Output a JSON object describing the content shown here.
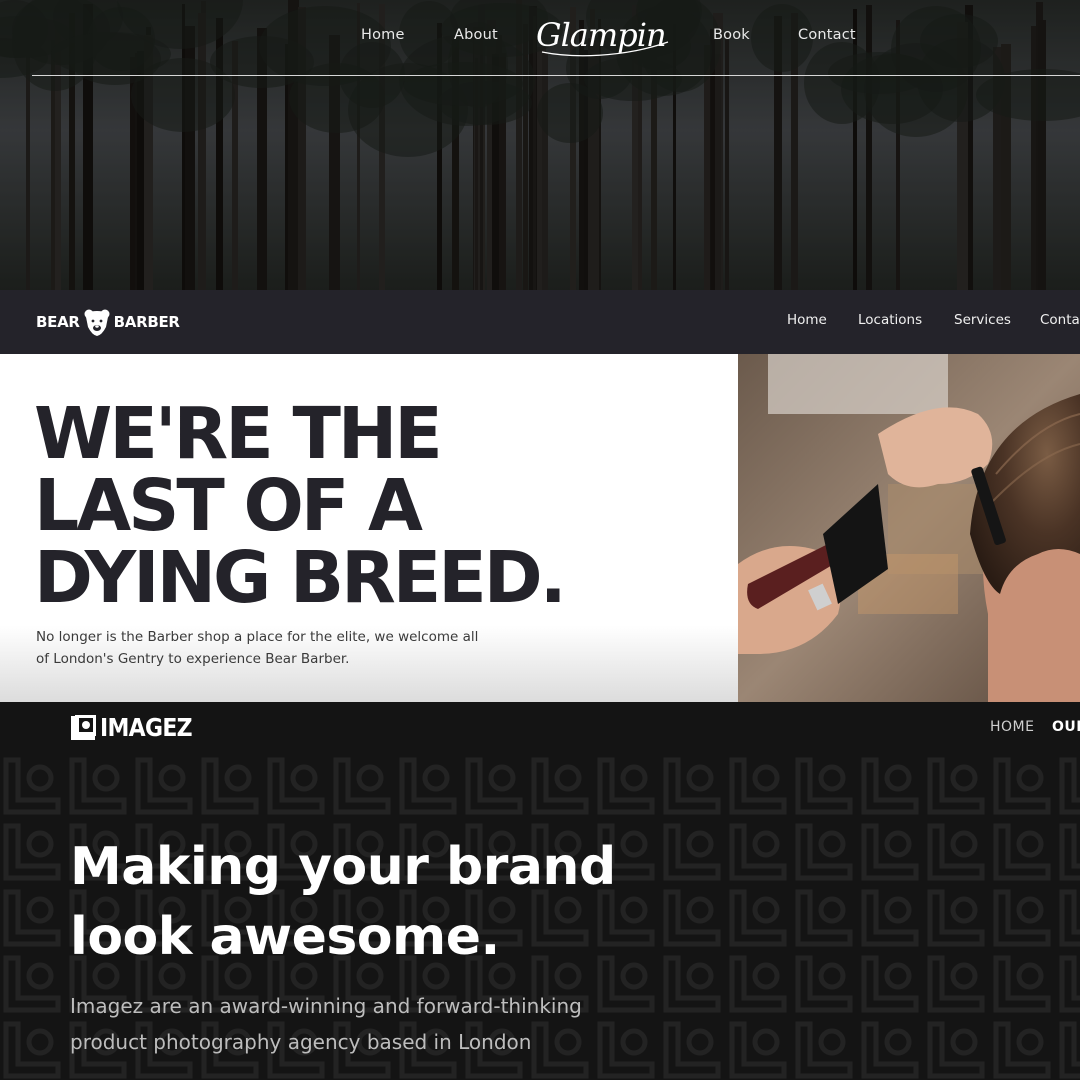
{
  "glampin": {
    "nav": [
      "Home",
      "About",
      "Book",
      "Contact"
    ],
    "logo_text": "Glampin"
  },
  "bear_barber": {
    "logo_left": "BEAR",
    "logo_right": "BARBER",
    "nav": [
      "Home",
      "Locations",
      "Services",
      "Contac"
    ],
    "headline": [
      "WE'RE THE",
      "LAST OF A",
      "DYING BREED."
    ],
    "subtext": "No longer is the Barber shop a place for the elite, we welcome all of London's Gentry to experience Bear Barber.",
    "colors": {
      "nav_bg": "#24232a",
      "headline": "#24232a"
    }
  },
  "imagez": {
    "logo_text": "IMAGEZ",
    "nav": [
      "HOME",
      "OUR"
    ],
    "headline": [
      "Making your brand",
      "look awesome."
    ],
    "subtext": "Imagez are an award-winning and forward-thinking product photography agency based in London",
    "colors": {
      "bg": "#141414"
    }
  }
}
